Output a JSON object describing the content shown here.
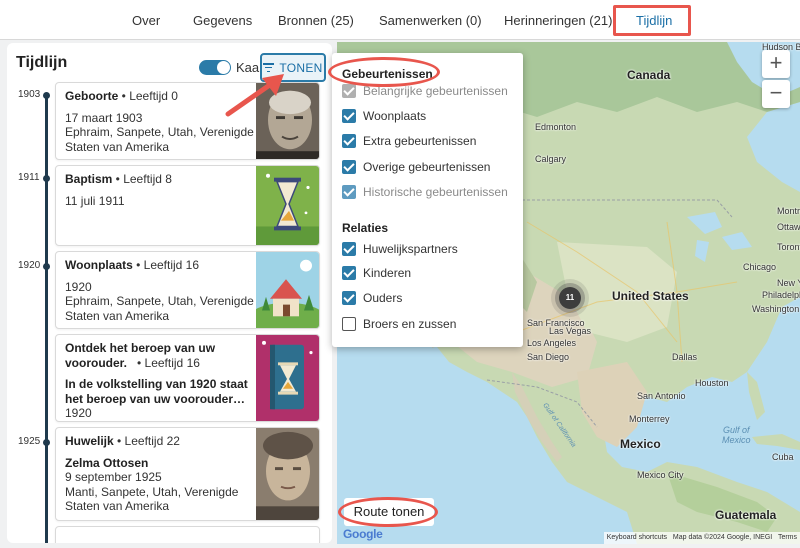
{
  "tabs": [
    {
      "label": "Over"
    },
    {
      "label": "Gegevens"
    },
    {
      "label": "Bronnen (25)"
    },
    {
      "label": "Samenwerken (0)"
    },
    {
      "label": "Herinneringen (21)"
    },
    {
      "label": "Tijdlijn",
      "active": true
    }
  ],
  "panel": {
    "title": "Tijdlijn",
    "map_toggle_label": "Kaart",
    "map_toggle_on": true,
    "show_button_label": "TONEN"
  },
  "timeline": {
    "years": [
      "1903",
      "1911",
      "1920",
      "1925"
    ],
    "events": [
      {
        "title": "Geboorte",
        "age": " • Leeftijd 0",
        "date": "17 maart 1903",
        "place": "Ephraim, Sanpete, Utah, Verenigde Staten van Amerika",
        "image": "portrait-photo-old-man"
      },
      {
        "title": "Baptism",
        "age": " • Leeftijd 8",
        "date": "11 juli 1911",
        "image": "hourglass-illustration-green"
      },
      {
        "title": "Woonplaats",
        "age": " • Leeftijd 16",
        "date": "1920",
        "place": "Ephraim, Sanpete, Utah, Verenigde Staten van Amerika",
        "image": "house-illustration-blue"
      },
      {
        "title": "Ontdek het beroep van uw voorouder.",
        "age": " • Leeftijd 16",
        "subtitle": "In de volkstelling van 1920 staat het beroep van uw voorouder in...",
        "date": "1920",
        "image": "book-hourglass-illustration-magenta"
      },
      {
        "title": "Huwelijk",
        "age": " • Leeftijd 22",
        "spouse": "Zelma Ottosen",
        "date": "9 september 1925",
        "place": "Manti, Sanpete, Utah, Verenigde Staten van Amerika",
        "image": "portrait-photo-woman"
      }
    ]
  },
  "dropdown": {
    "events_heading": "Gebeurtenissen",
    "event_options": [
      {
        "label": "Belangrijke gebeurtenissen",
        "checked": true,
        "disabled": true
      },
      {
        "label": "Woonplaats",
        "checked": true,
        "disabled": false
      },
      {
        "label": "Extra gebeurtenissen",
        "checked": true,
        "disabled": false
      },
      {
        "label": "Overige gebeurtenissen",
        "checked": true,
        "disabled": false
      },
      {
        "label": "Historische gebeurtenissen",
        "checked": true,
        "disabled": true
      }
    ],
    "relations_heading": "Relaties",
    "relation_options": [
      {
        "label": "Huwelijkspartners",
        "checked": true
      },
      {
        "label": "Kinderen",
        "checked": true
      },
      {
        "label": "Ouders",
        "checked": true
      },
      {
        "label": "Broers en zussen",
        "checked": false
      }
    ]
  },
  "map": {
    "labels": {
      "hudson_bay": "Hudson Ba",
      "canada": "Canada",
      "edmonton": "Edmonton",
      "calgary": "Calgary",
      "united_states": "United States",
      "chicago": "Chicago",
      "new_york": "New Yo",
      "philadelphia": "Philadelphi",
      "washington": "Washington",
      "toronto": "Toront",
      "ottawa": "Ottaw",
      "montreal": "Montre",
      "san_francisco": "San Francisco",
      "las_vegas": "Las Vegas",
      "los_angeles": "Los Angeles",
      "san_diego": "San Diego",
      "dallas": "Dallas",
      "houston": "Houston",
      "san_antonio": "San Antonio",
      "mexico": "Mexico",
      "monterrey": "Monterrey",
      "mexico_city": "Mexico City",
      "guatemala": "Guatemala",
      "gulf_of_mexico": "Gulf of\nMexico",
      "gulf_of_california": "Gulf of California",
      "cuba": "Cuba"
    },
    "cluster_count": "11",
    "zoom_in": "+",
    "zoom_out": "−",
    "route_button": "Route tonen",
    "attribution": {
      "shortcuts": "Keyboard shortcuts",
      "map_data": "Map data ©2024 Google, INEGI",
      "terms": "Terms"
    },
    "google_logo": "Google"
  },
  "colors": {
    "accent": "#2b7ba8",
    "highlight": "#e8564d",
    "timeline_line": "#1f3a4d"
  }
}
